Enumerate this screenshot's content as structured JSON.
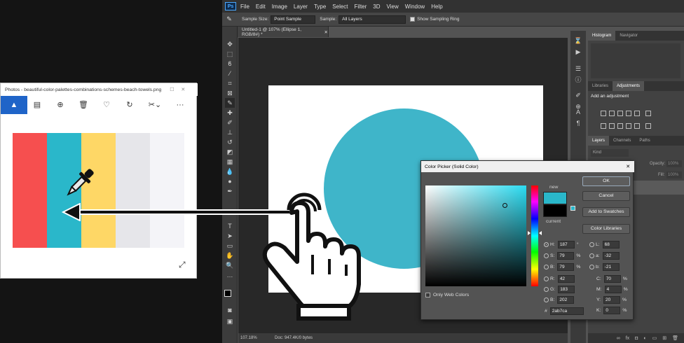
{
  "photos": {
    "title": "Photos - beautiful-color-palettes-combinations-schemes-beach-towels.png",
    "toolbar_icons": [
      "image-icon",
      "slideshow-icon",
      "zoom-icon",
      "delete-icon",
      "heart-icon",
      "rotate-icon",
      "edit-icon",
      "chevron-down-icon",
      "more-icon"
    ],
    "swatches": [
      "#f64f4f",
      "#2ab7ca",
      "#fed766",
      "#e6e6ea",
      "#f4f4f8"
    ]
  },
  "photoshop": {
    "logo": "Ps",
    "menu": [
      "File",
      "Edit",
      "Image",
      "Layer",
      "Type",
      "Select",
      "Filter",
      "3D",
      "View",
      "Window",
      "Help"
    ],
    "options": {
      "sample_size_label": "Sample Size:",
      "sample_size_value": "Point Sample",
      "sample_label": "Sample:",
      "sample_value": "All Layers",
      "sampling_ring_label": "Show Sampling Ring"
    },
    "doc_tab": "Untitled-1 @ 107% (Ellipse 1, RGB/8#) *",
    "ellipse_color": "#3fb5c9",
    "status": {
      "zoom": "107.18%",
      "doc": "Doc: 947.4K/0 bytes"
    },
    "panels": {
      "top_tabs": [
        "Histogram",
        "Navigator"
      ],
      "mid_tabs": [
        "Libraries",
        "Adjustments"
      ],
      "add_adjustment": "Add an adjustment",
      "layer_tabs": [
        "Layers",
        "Channels",
        "Paths"
      ],
      "kind": "Kind",
      "opacity_label": "Opacity:",
      "opacity_value": "100%",
      "fill_label": "Fill:",
      "fill_value": "100%"
    }
  },
  "color_picker": {
    "title": "Color Picker (Solid Color)",
    "close": "✕",
    "new_label": "new",
    "current_label": "current",
    "new_color": "#2ab7ca",
    "current_color": "#000000",
    "buttons": {
      "ok": "OK",
      "cancel": "Cancel",
      "add_swatches": "Add to Swatches",
      "color_libraries": "Color Libraries"
    },
    "only_web_colors": "Only Web Colors",
    "hsb": [
      {
        "label": "H:",
        "value": "187",
        "unit": "°"
      },
      {
        "label": "S:",
        "value": "79",
        "unit": "%"
      },
      {
        "label": "B:",
        "value": "79",
        "unit": "%"
      }
    ],
    "rgb": [
      {
        "label": "R:",
        "value": "42"
      },
      {
        "label": "G:",
        "value": "183"
      },
      {
        "label": "B:",
        "value": "202"
      }
    ],
    "lab": [
      {
        "label": "L:",
        "value": "68"
      },
      {
        "label": "a:",
        "value": "-32"
      },
      {
        "label": "b:",
        "value": "-21"
      }
    ],
    "cmyk": [
      {
        "label": "C:",
        "value": "70",
        "unit": "%"
      },
      {
        "label": "M:",
        "value": "4",
        "unit": "%"
      },
      {
        "label": "Y:",
        "value": "20",
        "unit": "%"
      },
      {
        "label": "K:",
        "value": "0",
        "unit": "%"
      }
    ],
    "hex_label": "#",
    "hex_value": "2ab7ca"
  }
}
